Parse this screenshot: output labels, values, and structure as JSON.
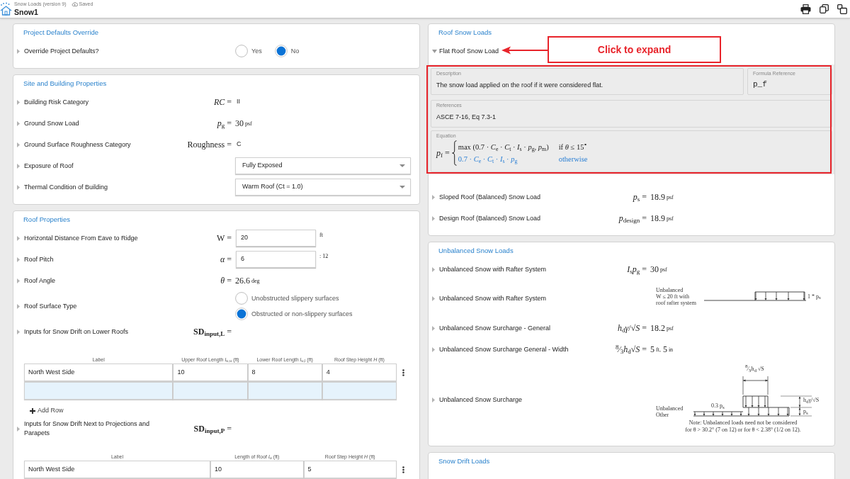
{
  "header": {
    "version_label": "Snow Loads (version 9)",
    "save_status": "Saved",
    "title": "Snow1"
  },
  "left_column": [
    {
      "title": "Project Defaults Override",
      "rows": [
        {
          "kind": "radio",
          "label": "Override Project Defaults?",
          "expanded": false,
          "options": [
            {
              "label": "Yes",
              "selected": false
            },
            {
              "label": "No",
              "selected": true
            }
          ]
        }
      ]
    },
    {
      "title": "Site and Building Properties",
      "rows": [
        {
          "kind": "text",
          "label": "Building Risk Category",
          "expanded": false,
          "symbol": "*RC* =",
          "value": "II"
        },
        {
          "kind": "value",
          "label": "Ground Snow Load",
          "expanded": false,
          "symbol": "*p*$_{g}$ =",
          "quantities": [
            {
              "number": "30",
              "unit": "psf"
            }
          ]
        },
        {
          "kind": "text",
          "label": "Ground Surface Roughness Category",
          "expanded": false,
          "symbol": "Roughness =",
          "value": "C"
        },
        {
          "kind": "select",
          "label": "Exposure of Roof",
          "expanded": false,
          "value": "Fully Exposed"
        },
        {
          "kind": "select",
          "label": "Thermal Condition of Building",
          "expanded": false,
          "value": "Warm Roof (Ct = 1.0)"
        }
      ]
    },
    {
      "title": "Roof Properties",
      "rows": [
        {
          "kind": "input",
          "label": "Horizontal Distance From Eave to Ridge",
          "expanded": false,
          "symbol": "W =",
          "value": "20",
          "unit": "ft"
        },
        {
          "kind": "input",
          "label": "Roof Pitch",
          "expanded": false,
          "symbol": "*α* =",
          "value": "6",
          "unit": ": 12"
        },
        {
          "kind": "value",
          "label": "Roof Angle",
          "expanded": false,
          "symbol": "*θ* =",
          "quantities": [
            {
              "number": "26.6",
              "unit": "deg"
            }
          ]
        },
        {
          "kind": "radio_stack",
          "label": "Roof Surface Type",
          "expanded": false,
          "options": [
            {
              "label": "Unobstructed slippery surfaces",
              "selected": false
            },
            {
              "label": "Obstructed or non-slippery surfaces",
              "selected": true
            }
          ]
        },
        {
          "kind": "table",
          "label": "Inputs for Snow Drift on Lower Roofs",
          "expanded": false,
          "symbol": "**SD**$_{input,L}$ =",
          "columns": [
            "Label",
            "Upper Roof Length *l*$_{u,u}$ (ft)",
            "Lower Roof Length *l*$_{u,l}$ (ft)",
            "Roof Step Height *H* (ft)"
          ],
          "rows": [
            [
              "North West Side",
              "10",
              "8",
              "4"
            ]
          ],
          "blank_row": true,
          "add_button": "Add Row"
        },
        {
          "kind": "table",
          "label": "Inputs for Snow Drift Next to Projections and Parapets",
          "expanded": false,
          "symbol": "**SD**$_{input,P}$ =",
          "columns": [
            "Label",
            "Length of Roof *l*$_{u}$ (ft)",
            "Roof Step Height *H* (ft)"
          ],
          "rows": [
            [
              "North West Side",
              "10",
              "5"
            ]
          ]
        }
      ]
    }
  ],
  "right_column": [
    {
      "title": "Roof Snow Loads",
      "rows": [
        {
          "kind": "details",
          "label": "Flat Roof Snow Load",
          "expanded": true,
          "callout": "Click to expand",
          "details": {
            "description_label": "Description",
            "description": "The snow load applied on the roof if it were considered flat.",
            "formula_label": "Formula Reference",
            "formula": "p_f",
            "references_label": "References",
            "references": "ASCE 7-16, Eq 7.3-1",
            "equation_label": "Equation",
            "equation": {
              "lhs": "*p*$_{f}$ =",
              "cases": [
                {
                  "expression": "max (0.7 · *C*$_{e}$ · *C*$_{t}$ · *I*$_{s}$ · *p*$_{g}$, *p*$_{m}$)",
                  "condition": "if *θ* ≤ 15$^{∘}$",
                  "selected": false
                },
                {
                  "expression": "0.7 · *C*$_{e}$ · *C*$_{t}$ · *I*$_{s}$ · *p*$_{g}$",
                  "condition": "otherwise",
                  "selected": true
                }
              ]
            }
          }
        },
        {
          "kind": "value",
          "label": "Sloped Roof (Balanced) Snow Load",
          "expanded": false,
          "symbol": "*p*$_{s}$ =",
          "quantities": [
            {
              "number": "18.9",
              "unit": "psf"
            }
          ]
        },
        {
          "kind": "value",
          "label": "Design Roof (Balanced) Snow Load",
          "expanded": false,
          "symbol": "*p*$_{design}$ =",
          "quantities": [
            {
              "number": "18.9",
              "unit": "psf"
            }
          ]
        }
      ]
    },
    {
      "title": "Unbalanced Snow Loads",
      "rows": [
        {
          "kind": "value",
          "label": "Unbalanced Snow with Rafter System",
          "expanded": false,
          "symbol": "*I*$_{s}$*p*$_{g}$ =",
          "quantities": [
            {
              "number": "30",
              "unit": "psf"
            }
          ]
        },
        {
          "kind": "rafter_diagram",
          "label": "Unbalanced Snow with Rafter System",
          "expanded": false,
          "diagram_labels": [
            "Unbalanced",
            "W ≤ 20 ft with",
            "roof rafter system",
            "1 * p$_{s}$"
          ]
        },
        {
          "kind": "value",
          "label": "Unbalanced Snow Surcharge - General",
          "expanded": false,
          "symbol": "*h*$_{d}$*γ*/√*S* =",
          "quantities": [
            {
              "number": "18.2",
              "unit": "psf"
            }
          ]
        },
        {
          "kind": "value",
          "label": "Unbalanced Snow Surcharge General - Width",
          "expanded": false,
          "symbol": "$^{8}$⁄$_{3}$*h*$_{d}$√*S* =",
          "quantities": [
            {
              "number": "5",
              "unit": "ft,"
            },
            {
              "number": "5",
              "unit": "in"
            }
          ]
        },
        {
          "kind": "surcharge_diagram",
          "label": "Unbalanced Snow Surcharge",
          "expanded": false,
          "diagram_labels": [
            "$^{8}$⁄$_{3}$h$_{d}$ √S",
            "0.3 p$_{s}$",
            "Unbalanced",
            "Other",
            "h$_{d}$γ/√S",
            "p$_{s}$",
            "Note: Unbalanced loads need not be considered",
            "for θ > 30.2° (7 on 12) or for θ < 2.38° (1/2 on 12)."
          ]
        }
      ]
    },
    {
      "title": "Snow Drift Loads"
    }
  ]
}
